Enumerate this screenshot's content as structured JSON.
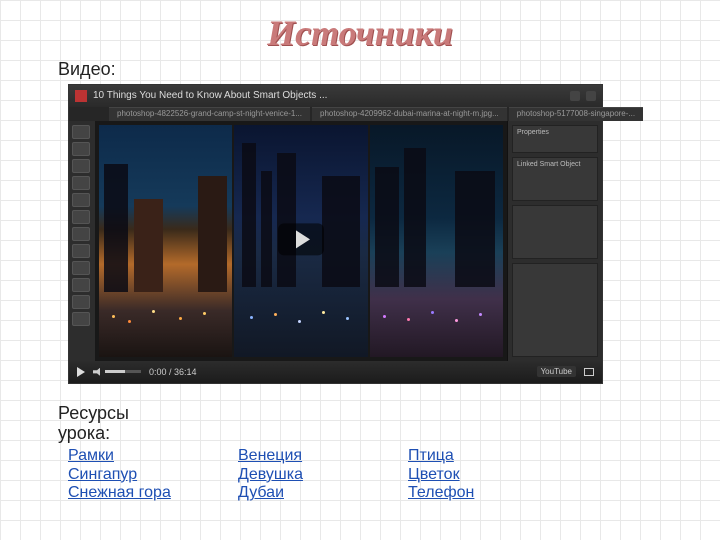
{
  "title": "Источники",
  "section_video": "Видео:",
  "section_resources": "Ресурсы урока:",
  "video": {
    "titlebar": "10 Things You Need to Know About Smart Objects ...",
    "tab1": "photoshop-4822526-grand-camp-st-night-venice-1...",
    "tab2": "photoshop-4209962-dubai-marina-at-night-m.jpg...",
    "tab3": "photoshop-5177008-singapore-...",
    "panel_label": "Properties",
    "panel_smart": "Linked Smart Object",
    "time": "0:00 / 36:14",
    "youtube": "YouTube"
  },
  "links": {
    "col1": {
      "a": "Рамки",
      "b": "Сингапур",
      "c": "Снежная гора"
    },
    "col2": {
      "a": "Венеция",
      "b": "Девушка",
      "c": "Дубаи"
    },
    "col3": {
      "a": "Птица",
      "b": "Цветок",
      "c": "Телефон"
    }
  }
}
